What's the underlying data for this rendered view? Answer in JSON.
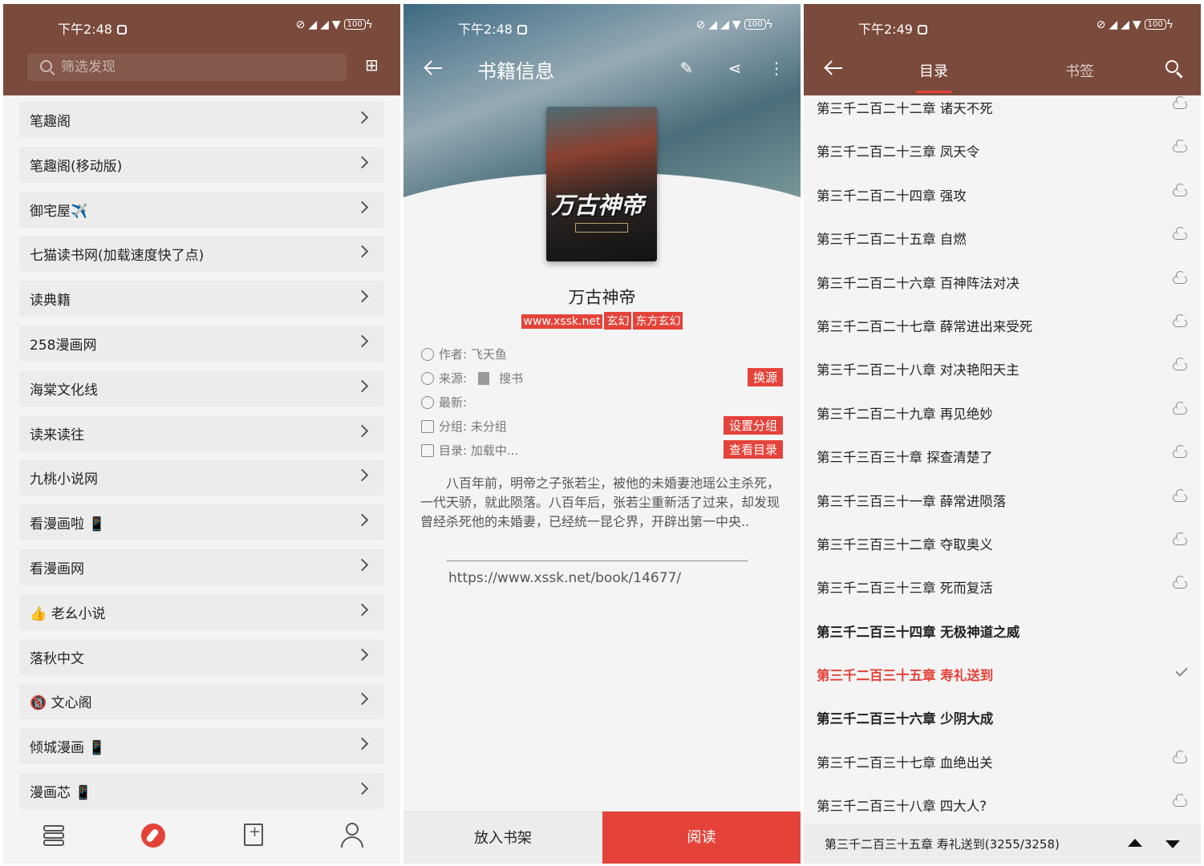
{
  "panel1": {
    "status": {
      "time": "下午2:48",
      "battery": "100"
    },
    "search": {
      "placeholder": "筛选发现"
    },
    "sources": [
      {
        "label": "笔趣阁"
      },
      {
        "label": "笔趣阁(移动版)"
      },
      {
        "label": "御宅屋✈️"
      },
      {
        "label": "七猫读书网(加载速度快了点)"
      },
      {
        "label": "读典籍"
      },
      {
        "label": "258漫画网"
      },
      {
        "label": "海棠文化线"
      },
      {
        "label": "读来读往"
      },
      {
        "label": "九桃小说网"
      },
      {
        "label": "看漫画啦 📱"
      },
      {
        "label": "看漫画网"
      },
      {
        "label": "👍 老幺小说"
      },
      {
        "label": "落秋中文"
      },
      {
        "label": "🔞 文心阁"
      },
      {
        "label": "倾城漫画 📱"
      },
      {
        "label": "漫画芯 📱"
      }
    ],
    "nav": [
      "bookshelf-icon",
      "discover-icon",
      "bookmark-add-icon",
      "user-icon"
    ]
  },
  "panel2": {
    "status": {
      "time": "下午2:48",
      "battery": "100"
    },
    "title": "书籍信息",
    "book": {
      "cover_title": "万古神帝",
      "name": "万古神帝",
      "tags": [
        "www.xssk.net",
        "玄幻",
        "东方玄幻"
      ],
      "author": "作者: 飞天鱼",
      "source_label": "来源:",
      "source_name": "搜书",
      "latest": "最新:",
      "group": "分组: 未分组",
      "toc": "目录: 加载中...",
      "intro": "八百年前，明帝之子张若尘，被他的未婚妻池瑶公主杀死，一代天骄，就此陨落。八百年后，张若尘重新活了过来，却发现曾经杀死他的未婚妻，已经统一昆仑界，开辟出第一中央..",
      "url": "https://www.xssk.net/book/14677/"
    },
    "buttons": {
      "change_source": "换源",
      "set_group": "设置分组",
      "view_toc": "查看目录",
      "add_shelf": "放入书架",
      "read": "阅读"
    }
  },
  "panel3": {
    "status": {
      "time": "下午2:49",
      "battery": "100"
    },
    "tabs": {
      "toc": "目录",
      "bookmark": "书签"
    },
    "chapters": [
      {
        "title": "第三千二百二十二章 诸天不死",
        "state": "remote"
      },
      {
        "title": "第三千二百二十三章 凤天令",
        "state": "remote"
      },
      {
        "title": "第三千二百二十四章 强攻",
        "state": "remote"
      },
      {
        "title": "第三千二百二十五章 自燃",
        "state": "remote"
      },
      {
        "title": "第三千二百二十六章 百神阵法对决",
        "state": "remote"
      },
      {
        "title": "第三千二百二十七章 薛常进出来受死",
        "state": "remote"
      },
      {
        "title": "第三千二百二十八章 对决艳阳天主",
        "state": "remote"
      },
      {
        "title": "第三千二百二十九章 再见绝妙",
        "state": "remote"
      },
      {
        "title": "第三千三百三十章 探查清楚了",
        "state": "remote"
      },
      {
        "title": "第三千三百三十一章 薛常进陨落",
        "state": "remote"
      },
      {
        "title": "第三千三百三十二章 夺取奥义",
        "state": "remote"
      },
      {
        "title": "第三千二百三十三章 死而复活",
        "state": "remote"
      },
      {
        "title": "第三千二百三十四章 无极神道之威",
        "state": "cached"
      },
      {
        "title": "第三千二百三十五章 寿礼送到",
        "state": "current"
      },
      {
        "title": "第三千二百三十六章 少阴大成",
        "state": "cached"
      },
      {
        "title": "第三千二百三十七章 血绝出关",
        "state": "remote"
      },
      {
        "title": "第三千二百三十八章 四大人?",
        "state": "remote"
      }
    ],
    "footer": {
      "current": "第三千二百三十五章 寿礼送到(3255/3258)"
    }
  },
  "colors": {
    "header": "#7a4a3c",
    "accent": "#e5433a",
    "background": "#f4f4f4"
  }
}
